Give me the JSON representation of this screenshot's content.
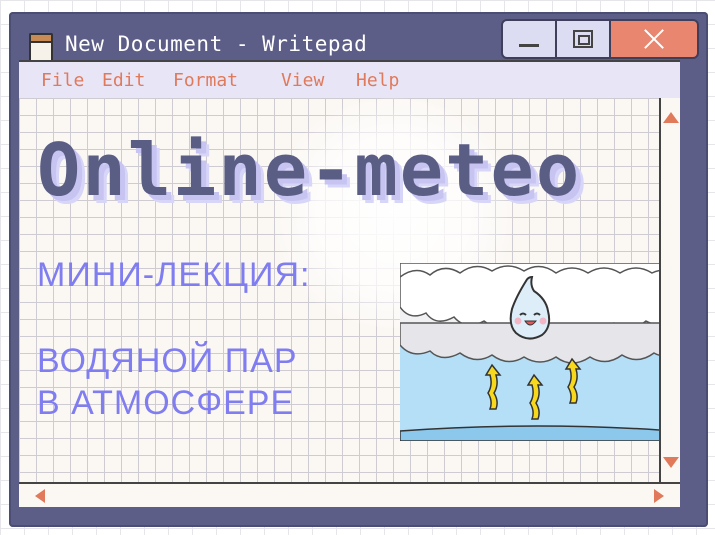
{
  "window": {
    "title": "New Document - Writepad",
    "buttons": {
      "minimize": "minimize",
      "maximize": "maximize",
      "close": "close"
    }
  },
  "menu": [
    {
      "label": "File"
    },
    {
      "label": "Edit"
    },
    {
      "label": "Format"
    },
    {
      "label": "View"
    },
    {
      "label": "Help"
    }
  ],
  "document": {
    "headline": "Online-meteo",
    "lecture_label": "МИНИ-ЛЕКЦИЯ:",
    "topic_line1": "ВОДЯНОЙ ПАР",
    "topic_line2": "В АТМОСФЕРЕ"
  },
  "illustration": {
    "subject": "water droplet rising from sea to clouds",
    "icons": [
      "cloud-icon",
      "water-drop-icon",
      "arrow-up-icon"
    ]
  },
  "colors": {
    "window_frame": "#5d5e87",
    "close_button": "#e8866f",
    "menu_text": "#e07a5b",
    "headline": "#5a5d84",
    "accent_text": "#7f7df0"
  }
}
